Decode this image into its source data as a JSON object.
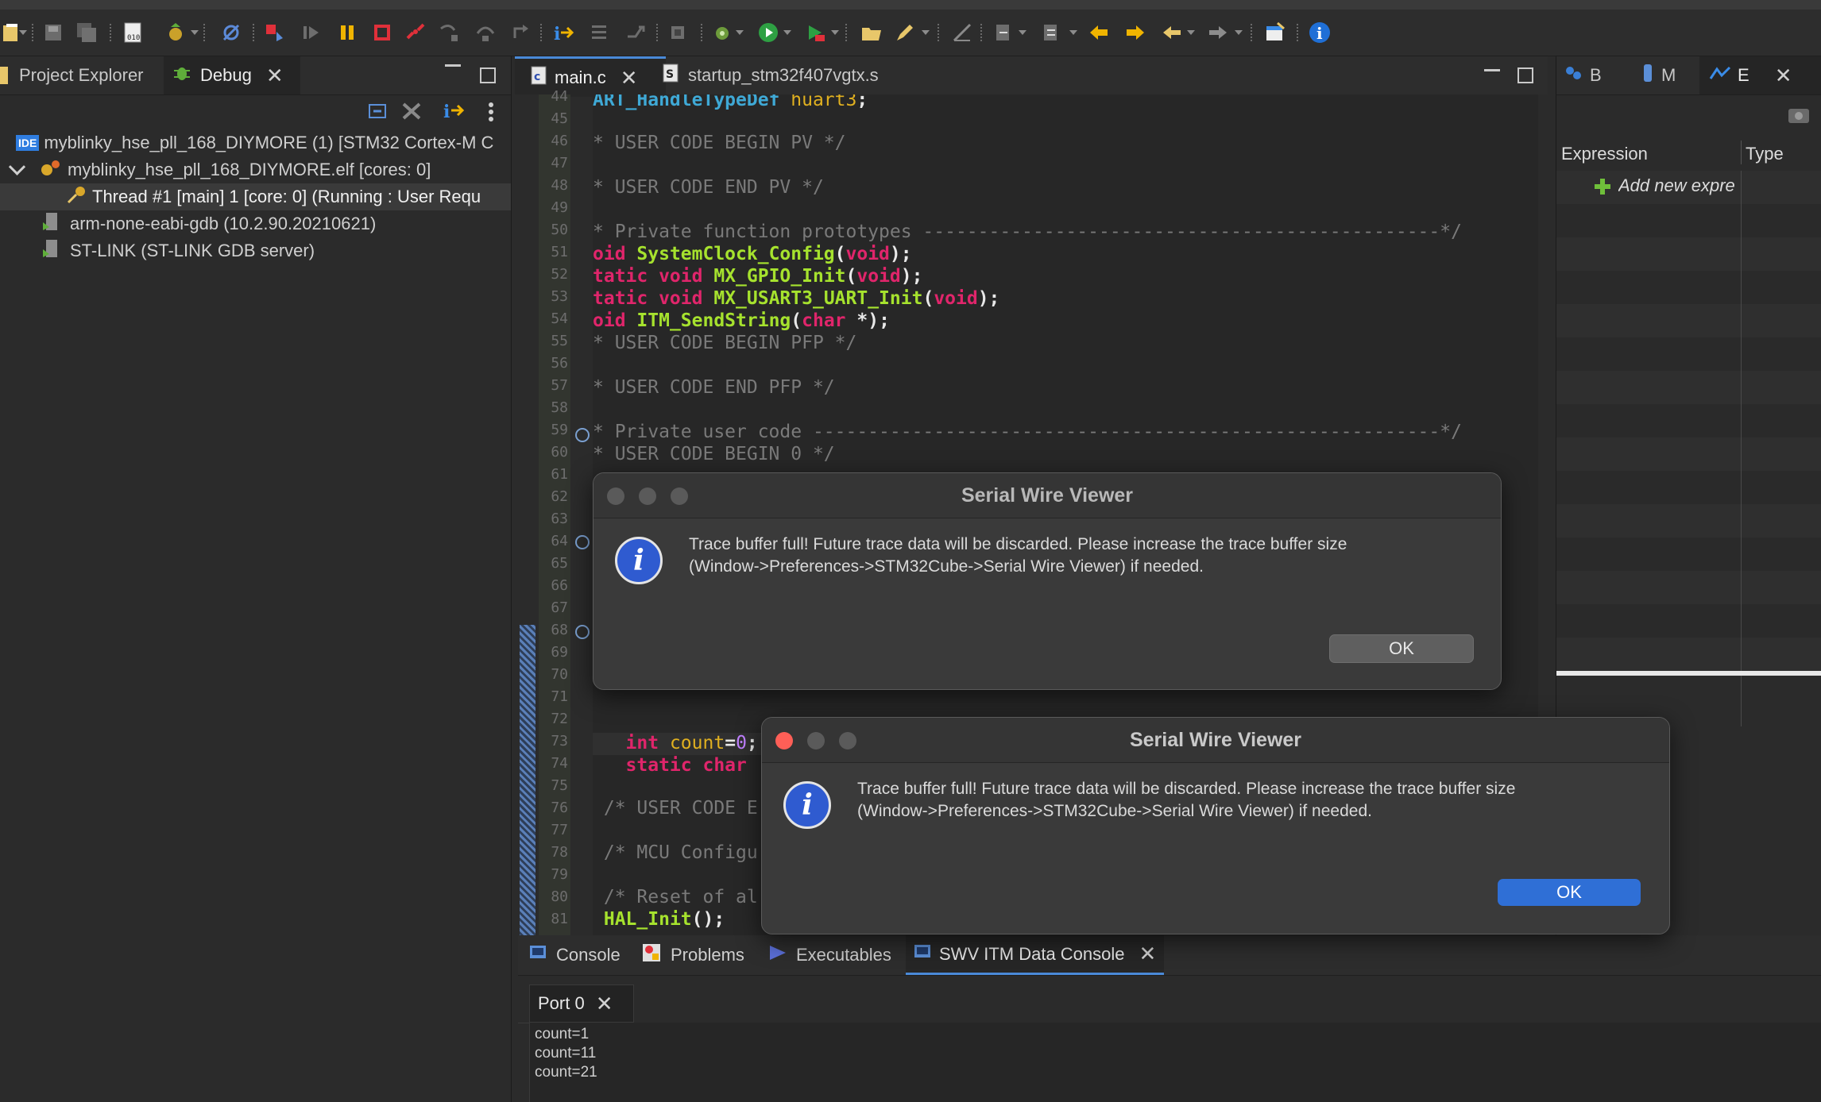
{
  "toolbar": {
    "icons": [
      "new-icon",
      "save-icon",
      "save-all-icon",
      "binary-icon",
      "debug-config-icon",
      "skip-breakpoints-icon",
      "terminate-relaunch-icon",
      "resume-icon",
      "suspend-icon",
      "terminate-icon",
      "disconnect-icon",
      "step-into-icon",
      "step-over-icon",
      "step-return-icon",
      "instruction-stepping-icon",
      "restart-icon",
      "drop-frame-icon",
      "hardware-icon",
      "run-debug-icon",
      "run-icon",
      "external-tools-icon",
      "open-folder-icon",
      "edit-icon",
      "annotation-icon",
      "prev-annotation-icon",
      "next-annotation-icon",
      "back-icon",
      "forward-icon",
      "open-perspective-icon",
      "info-icon"
    ]
  },
  "left": {
    "tabs": [
      {
        "label": "Project Explorer"
      },
      {
        "label": "Debug"
      }
    ],
    "tree": [
      {
        "label": "myblinky_hse_pll_168_DIYMORE (1) [STM32 Cortex-M C"
      },
      {
        "label": "myblinky_hse_pll_168_DIYMORE.elf [cores: 0]"
      },
      {
        "label": "Thread #1 [main] 1 [core: 0] (Running : User Requ"
      },
      {
        "label": "arm-none-eabi-gdb (10.2.90.20210621)"
      },
      {
        "label": "ST-LINK (ST-LINK GDB server)"
      }
    ],
    "ide_badge": "IDE"
  },
  "editor": {
    "tabs": [
      {
        "label": "main.c"
      },
      {
        "label": "startup_stm32f407vgtx.s"
      }
    ],
    "line_numbers": [
      "44",
      "45",
      "46",
      "47",
      "48",
      "49",
      "50",
      "51",
      "52",
      "53",
      "54",
      "55",
      "56",
      "57",
      "58",
      "59",
      "60",
      "61",
      "62",
      "63",
      "64",
      "65",
      "66",
      "67",
      "68",
      "69",
      "70",
      "71",
      "72",
      "73",
      "74",
      "75",
      "76",
      "77",
      "78",
      "79",
      "80",
      "81"
    ]
  },
  "right": {
    "tabs": [
      {
        "label": "B"
      },
      {
        "label": "M"
      },
      {
        "label": "E"
      }
    ],
    "columns": [
      "Expression",
      "Type"
    ],
    "add_new": "Add new expre"
  },
  "console": {
    "tabs": [
      {
        "label": "Console"
      },
      {
        "label": "Problems"
      },
      {
        "label": "Executables"
      },
      {
        "label": "SWV ITM Data Console"
      }
    ],
    "port_tab": "Port 0",
    "lines": [
      "count=1",
      "count=11",
      "count=21"
    ]
  },
  "dialogs": [
    {
      "title": "Serial Wire Viewer",
      "line1": "Trace buffer full! Future trace data will be discarded. Please increase the trace buffer size",
      "line2": "(Window->Preferences->STM32Cube->Serial Wire Viewer) if needed.",
      "ok": "OK",
      "active": false
    },
    {
      "title": "Serial Wire Viewer",
      "line1": "Trace buffer full! Future trace data will be discarded. Please increase the trace buffer size",
      "line2": "(Window->Preferences->STM32Cube->Serial Wire Viewer) if needed.",
      "ok": "OK",
      "active": true
    }
  ],
  "colors": {
    "accent_blue": "#2f6fd6",
    "close_red": "#fe5f57",
    "keyword": "#e0256b",
    "function": "#a6e22e",
    "type": "#3fa9d6"
  }
}
